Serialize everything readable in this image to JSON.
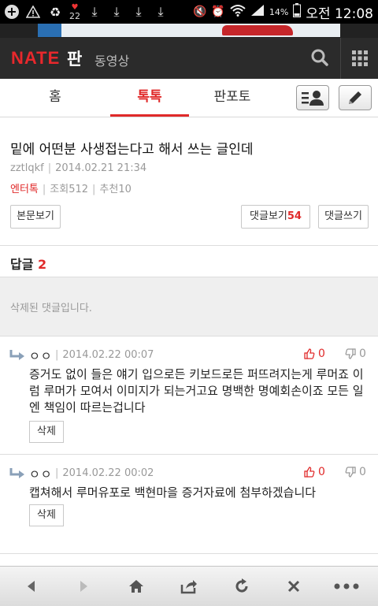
{
  "statusbar": {
    "notif_count": "22",
    "battery": "14%",
    "time": "오전 12:08"
  },
  "header": {
    "logo": "NATE",
    "logo_sub": "판",
    "video_link": "동영상"
  },
  "tabs": [
    {
      "label": "홈",
      "active": false
    },
    {
      "label": "톡톡",
      "active": true
    },
    {
      "label": "판포토",
      "active": false
    }
  ],
  "article": {
    "title": "밑에 어떤분 사생접는다고 해서 쓰는 글인데",
    "author": "zztlqkf",
    "datetime": "2014.02.21 21:34",
    "category": "엔터톡",
    "views": "조회512",
    "recommends": "추천10",
    "btn_body": "본문보기",
    "btn_comments": "댓글보기",
    "comment_count": "54",
    "btn_write_comment": "댓글쓰기"
  },
  "replies": {
    "label": "답글",
    "count": "2",
    "deleted_text": "삭제된 댓글입니다.",
    "items": [
      {
        "author": "ㅇㅇ",
        "datetime": "2014.02.22 00:07",
        "likes": "0",
        "dislikes": "0",
        "text": "증거도 없이 들은 얘기 입으로든 키보드로든 퍼뜨려지는게 루머죠 이럼 루머가 모여서 이미지가 되는거고요 명백한 명예회손이죠 모든 일엔 책임이 따르는겁니다",
        "delete_label": "삭제"
      },
      {
        "author": "ㅇㅇ",
        "datetime": "2014.02.22 00:02",
        "likes": "0",
        "dislikes": "0",
        "text": "캡쳐해서 루머유포로 백현마을 증거자료에 첨부하겠습니다",
        "delete_label": "삭제"
      }
    ]
  },
  "colors": {
    "accent": "#e02a2a",
    "header_bg": "#2b2b2b"
  },
  "bottombar": {
    "icons": [
      "back-icon",
      "forward-icon",
      "home-icon",
      "share-icon",
      "refresh-icon",
      "close-icon",
      "more-icon"
    ]
  }
}
